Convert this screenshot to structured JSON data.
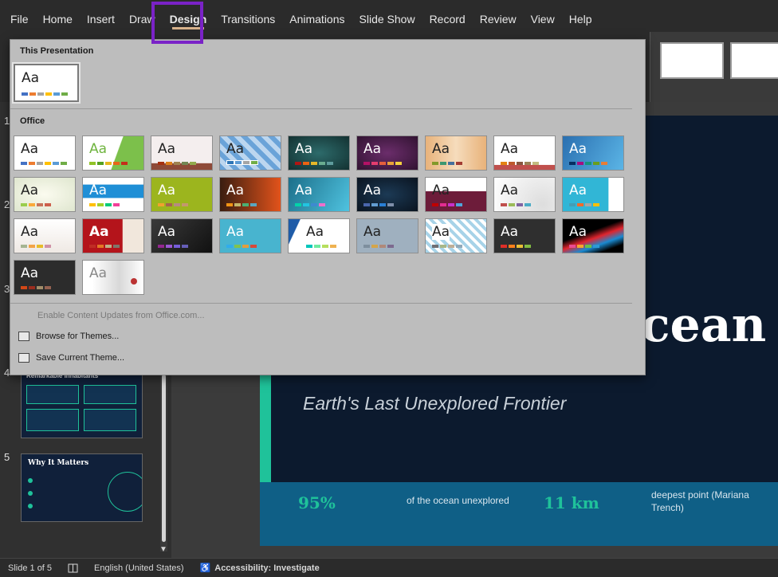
{
  "menu": {
    "items": [
      "File",
      "Home",
      "Insert",
      "Draw",
      "Design",
      "Transitions",
      "Animations",
      "Slide Show",
      "Record",
      "Review",
      "View",
      "Help"
    ],
    "active_index": 4
  },
  "dropdown": {
    "this_presentation_label": "This Presentation",
    "office_label": "Office",
    "theme_sample": "Aa",
    "enable_updates": "Enable Content Updates from Office.com...",
    "browse_themes": "Browse for Themes...",
    "save_theme": "Save Current Theme..."
  },
  "slides": {
    "visible_numbers": [
      "1",
      "2",
      "3",
      "4",
      "5"
    ],
    "thumb4_title": "Remarkable Inhabitants",
    "thumb5_title": "Why It Matters"
  },
  "slide": {
    "title_fragment": "cean",
    "subtitle": "Earth's Last Unexplored Frontier",
    "stat1_value": "95%",
    "stat1_label": "of the ocean unexplored",
    "stat2_value": "11 km",
    "stat2_label": "deepest point (Mariana Trench)"
  },
  "status": {
    "slide_position": "Slide 1 of 5",
    "language": "English (United States)",
    "accessibility": "Accessibility: Investigate"
  },
  "colors": {
    "highlight": "#7a22c7",
    "accent_green": "#1fc29a",
    "stats_band": "#0f5f86"
  }
}
